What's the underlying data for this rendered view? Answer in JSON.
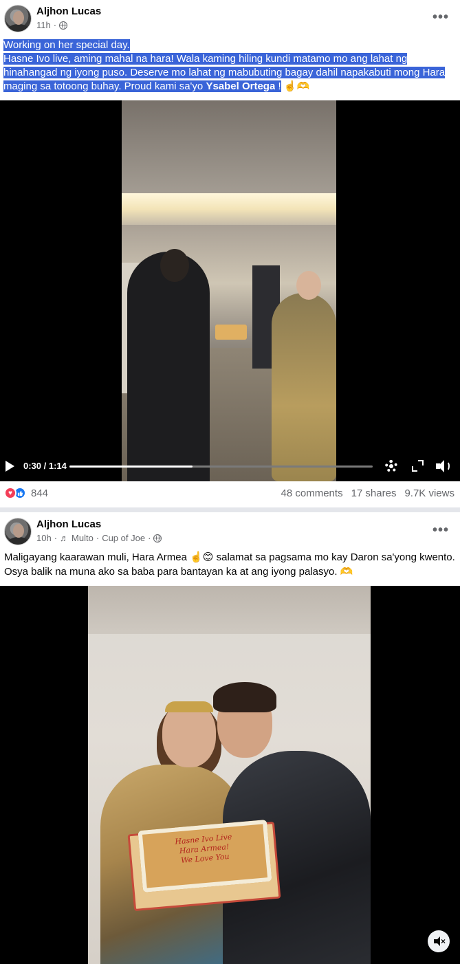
{
  "post1": {
    "author": "Aljhon Lucas",
    "time": "11h",
    "privacy_dot": "·",
    "more": "•••",
    "caption_line1": "Working on her special day.",
    "caption_line2_prefix": "Hasne Ivo live, aming mahal na hara! Wala kaming hiling kundi matamo mo ang lahat ng hinahangad ng iyong puso. Deserve mo lahat ng mabubuting bagay dahil napakabuti mong Hara maging sa totoong buhay. Proud kami sa'yo ",
    "caption_mention": "Ysabel Ortega",
    "caption_suffix": " !",
    "caption_emoji": " ☝️🫶",
    "video": {
      "time": "0:30 / 1:14",
      "progress_fraction": 0.405
    },
    "reactions_count": "844",
    "comments": "48 comments",
    "shares": "17 shares",
    "views": "9.7K views"
  },
  "post2": {
    "author": "Aljhon Lucas",
    "time": "10h",
    "music_prefix": "·",
    "song": "Multo",
    "artist_sep": "·",
    "artist": "Cup of Joe",
    "privacy_dot": "·",
    "more": "•••",
    "caption": "Maligayang kaarawan muli, Hara Armea ☝️😊 salamat sa pagsama mo kay Daron sa'yong kwento. Osya balik na muna ako sa baba para bantayan ka at ang iyong palasyo. 🫶",
    "cake_text": [
      "Hasne Ivo Live",
      "Hara Armea!",
      "We Love You"
    ]
  },
  "icons": {
    "music": "♬",
    "heart": "♥",
    "like": "👍",
    "mute_x": "×"
  },
  "colors": {
    "highlight": "#3a64d8",
    "like_blue": "#1877f2",
    "heart_red": "#f33e58",
    "meta_gray": "#65676b"
  }
}
